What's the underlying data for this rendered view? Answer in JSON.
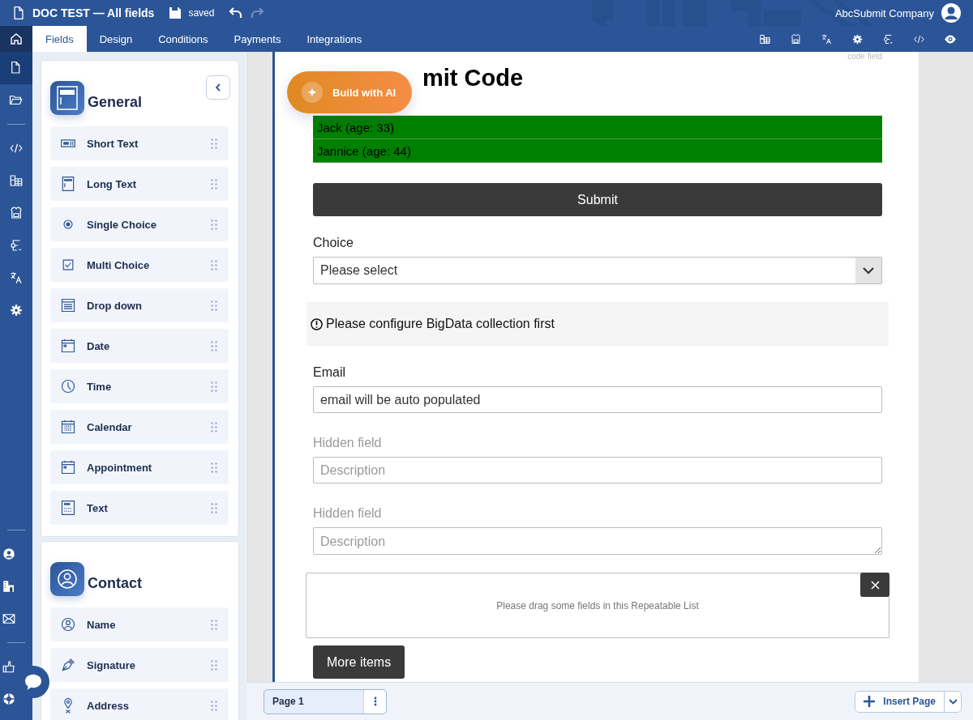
{
  "header": {
    "title": "DOC TEST — All fields",
    "save_status": "saved",
    "company": "AbcSubmit Company"
  },
  "tabs": [
    {
      "label": "Fields",
      "selected": true
    },
    {
      "label": "Design",
      "selected": false
    },
    {
      "label": "Conditions",
      "selected": false
    },
    {
      "label": "Payments",
      "selected": false
    },
    {
      "label": "Integrations",
      "selected": false
    }
  ],
  "rail_items": [
    {
      "kind": "document",
      "selected": true
    },
    {
      "kind": "folder",
      "selected": false
    },
    {
      "kind": "divider"
    },
    {
      "kind": "code",
      "selected": false
    },
    {
      "kind": "table",
      "selected": false
    },
    {
      "kind": "store",
      "selected": false
    },
    {
      "kind": "flow",
      "selected": false
    },
    {
      "kind": "translate",
      "selected": false
    },
    {
      "kind": "gear",
      "selected": false
    }
  ],
  "rail_bottom": [
    {
      "kind": "divider"
    },
    {
      "kind": "user",
      "selected": false
    },
    {
      "kind": "building",
      "selected": false
    },
    {
      "kind": "mail",
      "selected": false
    },
    {
      "kind": "divider"
    },
    {
      "kind": "thumb",
      "selected": false
    },
    {
      "kind": "help",
      "selected": false
    }
  ],
  "panel": {
    "sections": [
      {
        "title": "General",
        "kind": "general",
        "collapse_button": true,
        "items": [
          {
            "label": "Short Text",
            "kind": "short-text"
          },
          {
            "label": "Long Text",
            "kind": "long-text"
          },
          {
            "label": "Single Choice",
            "kind": "radio"
          },
          {
            "label": "Multi Choice",
            "kind": "checkbox"
          },
          {
            "label": "Drop down",
            "kind": "dropdown"
          },
          {
            "label": "Date",
            "kind": "date"
          },
          {
            "label": "Time",
            "kind": "time"
          },
          {
            "label": "Calendar",
            "kind": "calendar"
          },
          {
            "label": "Appointment",
            "kind": "date"
          },
          {
            "label": "Text",
            "kind": "text"
          }
        ]
      },
      {
        "title": "Contact",
        "kind": "contact",
        "collapse_button": false,
        "items": [
          {
            "label": "Name",
            "kind": "person"
          },
          {
            "label": "Signature",
            "kind": "pen"
          },
          {
            "label": "Address",
            "kind": "pin"
          }
        ]
      }
    ]
  },
  "form": {
    "code_field_label": "code field",
    "heading": "mit Code",
    "ai_button": "Build with AI",
    "list_rows": [
      "Jack (age: 33)",
      "Jannice (age: 44)"
    ],
    "submit": "Submit",
    "choice": {
      "label": "Choice",
      "value": "Please select"
    },
    "notice": "Please configure BigData collection first",
    "email": {
      "label": "Email",
      "value": "email will be auto populated"
    },
    "hidden_fields": [
      {
        "label": "Hidden field",
        "placeholder": "Description",
        "kind": "input"
      },
      {
        "label": "Hidden field",
        "placeholder": "Description",
        "kind": "textarea"
      }
    ],
    "repeatable": {
      "message": "Please drag some fields in this Repeatable List"
    },
    "more_button": "More items"
  },
  "footer": {
    "pages": [
      {
        "label": "Page 1",
        "selected": true
      }
    ],
    "insert_button": "Insert Page"
  }
}
